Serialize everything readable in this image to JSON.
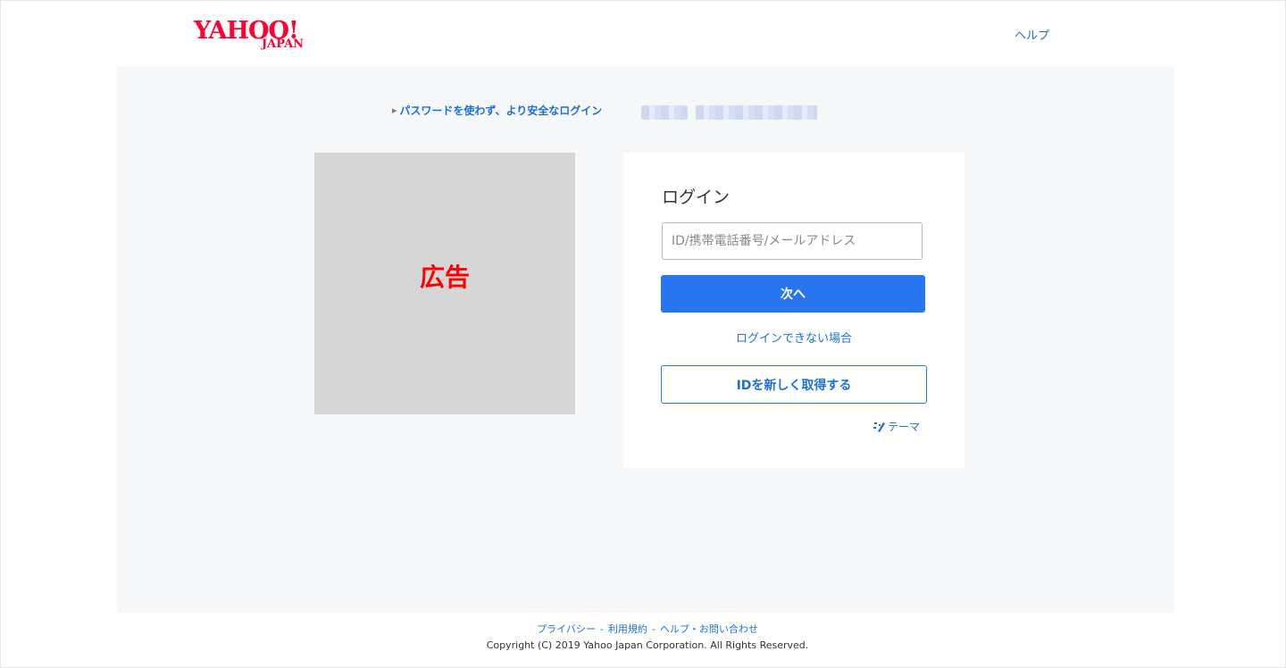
{
  "header": {
    "logo_main": "YAHOO!",
    "logo_sub": "JAPAN",
    "help_label": "ヘルプ"
  },
  "banner": {
    "passkey_link": "パスワードを使わず、より安全なログイン"
  },
  "ad": {
    "label": "広告"
  },
  "login": {
    "title": "ログイン",
    "id_input": {
      "value": "",
      "placeholder": "ID/携帯電話番号/メールアドレス"
    },
    "next_label": "次へ",
    "trouble_link": "ログインできない場合",
    "register_label": "IDを新しく取得する",
    "theme_label": "テーマ"
  },
  "footer": {
    "links": [
      "プライバシー",
      "利用規約",
      "ヘルプ・お問い合わせ"
    ],
    "separator": "-",
    "copyright": "Copyright (C) 2019 Yahoo Japan Corporation. All Rights Reserved."
  },
  "colors": {
    "brand_red": "#ff0033",
    "link_blue": "#1e6fd9",
    "primary_button": "#2875f0",
    "page_background": "#f6f7f9",
    "ad_placeholder": "#d6d6d6"
  }
}
